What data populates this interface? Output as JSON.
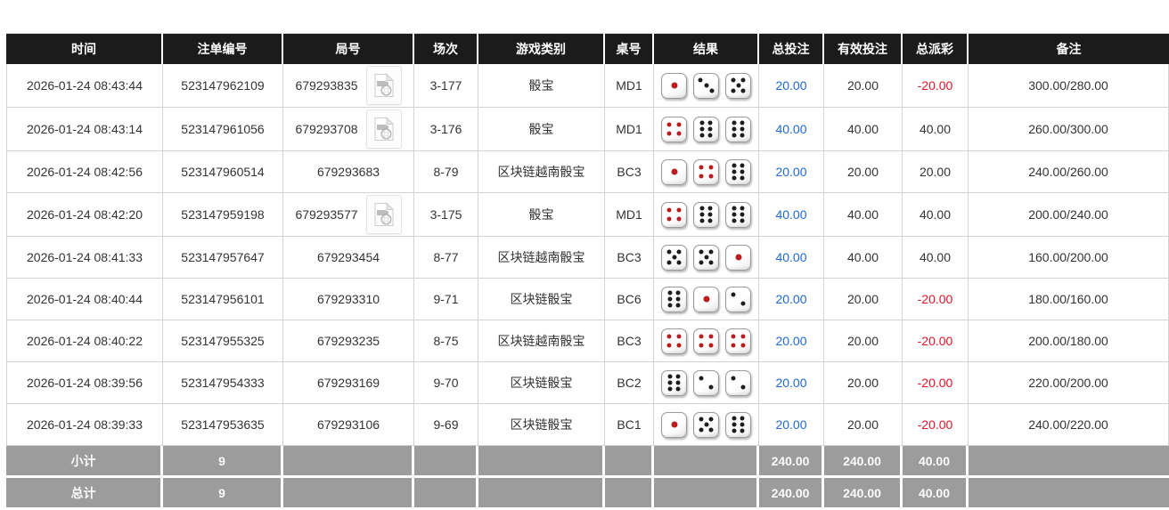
{
  "colors": {
    "header_bg": "#1b1b1b",
    "footer_bg": "#9c9c9c",
    "link_blue": "#1f68d4",
    "negative_red": "#e01428",
    "dice_pip_black": "#1d1d1d",
    "dice_pip_red": "#b81e1e",
    "grid_line": "#d2d2d2"
  },
  "table": {
    "headers": [
      "时间",
      "注单编号",
      "局号",
      "场次",
      "游戏类别",
      "桌号",
      "结果",
      "总投注",
      "有效投注",
      "总派彩",
      "备注"
    ],
    "rows": [
      {
        "time": "2026-01-24 08:43:44",
        "bet_id": "523147962109",
        "round_no": "679293835",
        "has_video": true,
        "session": "3-177",
        "game_type": "骰宝",
        "table_no": "MD1",
        "dice": [
          1,
          3,
          5
        ],
        "total_bet": "20.00",
        "valid_bet": "20.00",
        "payout": "-20.00",
        "remark": "300.00/280.00"
      },
      {
        "time": "2026-01-24 08:43:14",
        "bet_id": "523147961056",
        "round_no": "679293708",
        "has_video": true,
        "session": "3-176",
        "game_type": "骰宝",
        "table_no": "MD1",
        "dice": [
          4,
          6,
          6
        ],
        "total_bet": "40.00",
        "valid_bet": "40.00",
        "payout": "40.00",
        "remark": "260.00/300.00"
      },
      {
        "time": "2026-01-24 08:42:56",
        "bet_id": "523147960514",
        "round_no": "679293683",
        "has_video": false,
        "session": "8-79",
        "game_type": "区块链越南骰宝",
        "table_no": "BC3",
        "dice": [
          1,
          4,
          6
        ],
        "total_bet": "20.00",
        "valid_bet": "20.00",
        "payout": "20.00",
        "remark": "240.00/260.00"
      },
      {
        "time": "2026-01-24 08:42:20",
        "bet_id": "523147959198",
        "round_no": "679293577",
        "has_video": true,
        "session": "3-175",
        "game_type": "骰宝",
        "table_no": "MD1",
        "dice": [
          4,
          6,
          6
        ],
        "total_bet": "40.00",
        "valid_bet": "40.00",
        "payout": "40.00",
        "remark": "200.00/240.00"
      },
      {
        "time": "2026-01-24 08:41:33",
        "bet_id": "523147957647",
        "round_no": "679293454",
        "has_video": false,
        "session": "8-77",
        "game_type": "区块链越南骰宝",
        "table_no": "BC3",
        "dice": [
          5,
          5,
          1
        ],
        "total_bet": "40.00",
        "valid_bet": "40.00",
        "payout": "40.00",
        "remark": "160.00/200.00"
      },
      {
        "time": "2026-01-24 08:40:44",
        "bet_id": "523147956101",
        "round_no": "679293310",
        "has_video": false,
        "session": "9-71",
        "game_type": "区块链骰宝",
        "table_no": "BC6",
        "dice": [
          6,
          1,
          2
        ],
        "total_bet": "20.00",
        "valid_bet": "20.00",
        "payout": "-20.00",
        "remark": "180.00/160.00"
      },
      {
        "time": "2026-01-24 08:40:22",
        "bet_id": "523147955325",
        "round_no": "679293235",
        "has_video": false,
        "session": "8-75",
        "game_type": "区块链越南骰宝",
        "table_no": "BC3",
        "dice": [
          4,
          4,
          4
        ],
        "total_bet": "20.00",
        "valid_bet": "20.00",
        "payout": "-20.00",
        "remark": "200.00/180.00"
      },
      {
        "time": "2026-01-24 08:39:56",
        "bet_id": "523147954333",
        "round_no": "679293169",
        "has_video": false,
        "session": "9-70",
        "game_type": "区块链骰宝",
        "table_no": "BC2",
        "dice": [
          6,
          2,
          2
        ],
        "total_bet": "20.00",
        "valid_bet": "20.00",
        "payout": "-20.00",
        "remark": "220.00/200.00"
      },
      {
        "time": "2026-01-24 08:39:33",
        "bet_id": "523147953635",
        "round_no": "679293106",
        "has_video": false,
        "session": "9-69",
        "game_type": "区块链骰宝",
        "table_no": "BC1",
        "dice": [
          1,
          5,
          6
        ],
        "total_bet": "20.00",
        "valid_bet": "20.00",
        "payout": "-20.00",
        "remark": "240.00/220.00"
      }
    ],
    "subtotal": {
      "label": "小计",
      "count": "9",
      "total_bet": "240.00",
      "valid_bet": "240.00",
      "payout": "40.00"
    },
    "total": {
      "label": "总计",
      "count": "9",
      "total_bet": "240.00",
      "valid_bet": "240.00",
      "payout": "40.00"
    },
    "icons": {
      "video_icon_name": "video-file-icon"
    }
  }
}
